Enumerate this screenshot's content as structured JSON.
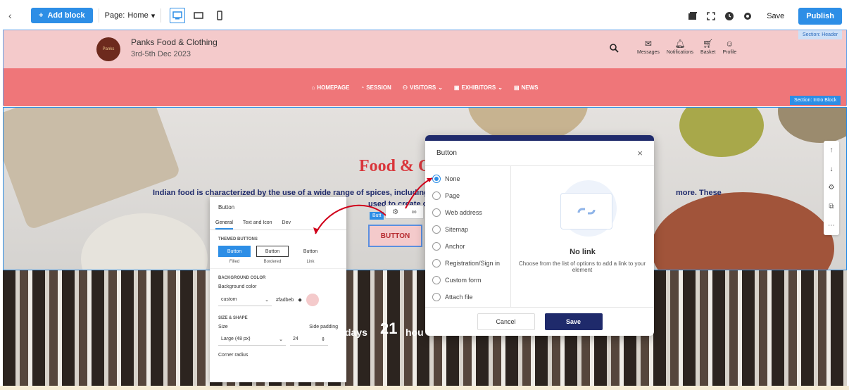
{
  "topbar": {
    "add_block": "Add block",
    "page_label": "Page:",
    "page_value": "Home",
    "save": "Save",
    "publish": "Publish"
  },
  "header": {
    "site_title": "Panks Food & Clothing",
    "site_date": "3rd-5th Dec 2023",
    "logo_text": "Panks",
    "icons": [
      {
        "label": "Messages",
        "icon": "envelope-icon"
      },
      {
        "label": "Notifications",
        "icon": "bell-icon"
      },
      {
        "label": "Basket",
        "icon": "cart-icon"
      },
      {
        "label": "Profile",
        "icon": "avatar-icon"
      }
    ],
    "section_tag": "Section: Header",
    "nav": [
      "HOMEPAGE",
      "SESSION",
      "VISITORS",
      "EXHIBITORS",
      "NEWS"
    ]
  },
  "intro": {
    "section_tag": "Section: Intro Block",
    "title": "Food & C",
    "text_line1": "Indian food is characterized by the use of a wide range of spices, including",
    "text_line2": "used to create compl",
    "text_line3": "more. These",
    "button_label": "BUTTON",
    "block_label": "Butt"
  },
  "lower": {
    "days_label": "days",
    "hours_value": "21",
    "hours_label": "hou"
  },
  "panel": {
    "title": "Button",
    "tabs": [
      "General",
      "Text and Icon",
      "Dev"
    ],
    "themed_title": "THEMED BUTTONS",
    "themes": [
      {
        "btn": "Button",
        "label": "Filled"
      },
      {
        "btn": "Button",
        "label": "Bordered"
      },
      {
        "btn": "Button",
        "label": "Link"
      }
    ],
    "bg_section": "BACKGROUND COLOR",
    "bg_label": "Background color",
    "bg_value": "custom",
    "bg_hex": "#fadbeb",
    "size_section": "SIZE & SHAPE",
    "size_label": "Size",
    "padding_label": "Side padding",
    "size_value": "Large (48 px)",
    "padding_value": "24",
    "corner_label": "Corner radius"
  },
  "dialog": {
    "title": "Button",
    "options": [
      "None",
      "Page",
      "Web address",
      "Sitemap",
      "Anchor",
      "Registration/Sign in",
      "Custom form",
      "Attach file"
    ],
    "selected": "None",
    "nolink_title": "No link",
    "nolink_text": "Choose from the list of options to add a link to your element",
    "cancel": "Cancel",
    "save": "Save"
  },
  "colors": {
    "accent": "#2d8ee6",
    "navy": "#1f2a6b",
    "header_pink": "#f4cacb",
    "nav_red": "#ef7679",
    "title_red": "#d9363b"
  }
}
